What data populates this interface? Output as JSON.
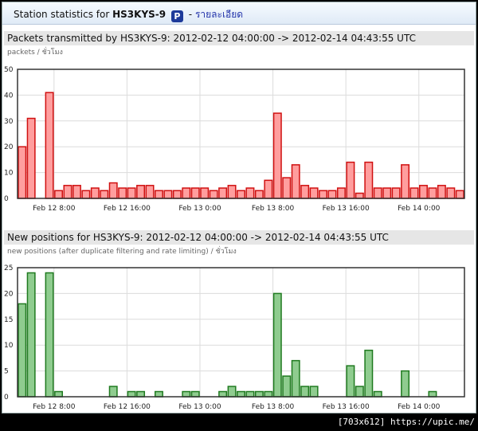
{
  "header": {
    "prefix": "Station statistics for",
    "callsign": "HS3KYS-9",
    "badge": "P",
    "sep": "-",
    "link": "รายละเอียด"
  },
  "footer": {
    "watermark": "[703x612] https://upic.me/"
  },
  "colors": {
    "packets_fill": "#ff9e9e",
    "packets_stroke": "#d01010",
    "positions_fill": "#8fcc8f",
    "positions_stroke": "#1f7a1f"
  },
  "chart_data": [
    {
      "type": "bar",
      "title": "Packets transmitted by HS3KYS-9: 2012-02-12 04:00:00 -> 2012-02-14 04:43:55 UTC",
      "subtitle": "packets / ชั่วโมง",
      "ylim": [
        0,
        50
      ],
      "yticks": [
        0,
        10,
        20,
        30,
        40,
        50
      ],
      "xtick_labels": [
        "Feb 12 8:00",
        "Feb 12 16:00",
        "Feb 13 0:00",
        "Feb 13 8:00",
        "Feb 13 16:00",
        "Feb 14 0:00"
      ],
      "xtick_hours": [
        4,
        12,
        20,
        28,
        36,
        44
      ],
      "grid": true,
      "values": [
        20,
        31,
        0,
        41,
        3,
        5,
        5,
        3,
        4,
        3,
        6,
        4,
        4,
        5,
        5,
        3,
        3,
        3,
        4,
        4,
        4,
        3,
        4,
        5,
        3,
        4,
        3,
        7,
        33,
        8,
        13,
        5,
        4,
        3,
        3,
        4,
        14,
        2,
        14,
        4,
        4,
        4,
        13,
        4,
        5,
        4,
        5,
        4,
        3
      ]
    },
    {
      "type": "bar",
      "title": "New positions for HS3KYS-9: 2012-02-12 04:00:00 -> 2012-02-14 04:43:55 UTC",
      "subtitle": "new positions (after duplicate filtering and rate limiting) / ชั่วโมง",
      "ylim": [
        0,
        25
      ],
      "yticks": [
        0,
        5,
        10,
        15,
        20,
        25
      ],
      "xtick_labels": [
        "Feb 12 8:00",
        "Feb 12 16:00",
        "Feb 13 0:00",
        "Feb 13 8:00",
        "Feb 13 16:00",
        "Feb 14 0:00"
      ],
      "xtick_hours": [
        4,
        12,
        20,
        28,
        36,
        44
      ],
      "grid": true,
      "values": [
        18,
        24,
        0,
        24,
        1,
        0,
        0,
        0,
        0,
        0,
        2,
        0,
        1,
        1,
        0,
        1,
        0,
        0,
        1,
        1,
        0,
        0,
        1,
        2,
        1,
        1,
        1,
        1,
        20,
        4,
        7,
        2,
        2,
        0,
        0,
        0,
        6,
        2,
        9,
        1,
        0,
        0,
        5,
        0,
        0,
        1,
        0,
        0,
        0
      ]
    }
  ]
}
